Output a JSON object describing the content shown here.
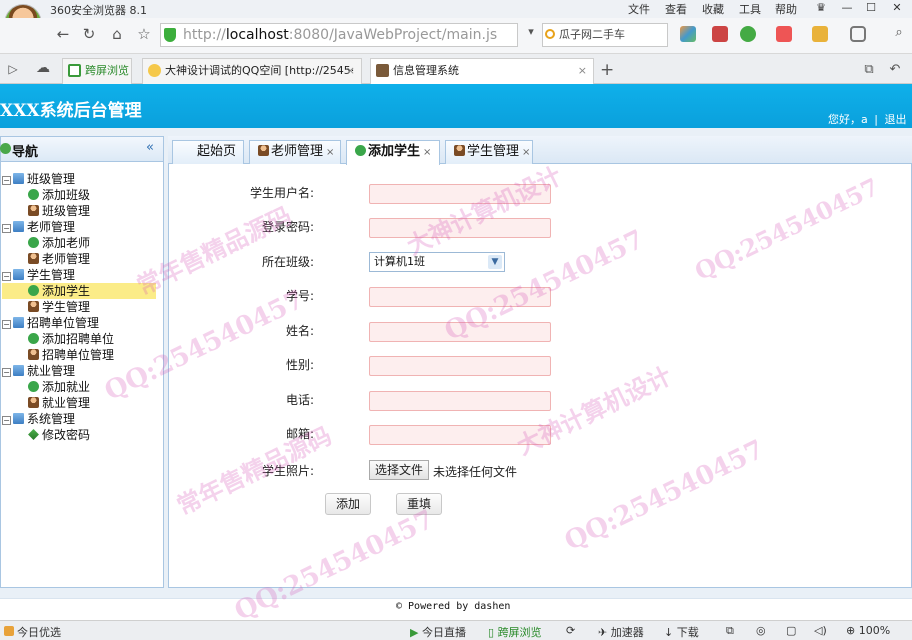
{
  "browser": {
    "title": "360安全浏览器 8.1",
    "menu": [
      "文件",
      "查看",
      "收藏",
      "工具",
      "帮助"
    ],
    "address_prefix": "http://",
    "address_host": "localhost",
    "address_rest": ":8080/JavaWebProject/main.js",
    "search_text": "瓜子网二手车",
    "tabs": [
      {
        "label": "跨屏浏览"
      },
      {
        "label": "大神设计调试的QQ空间 [http://2545·"
      },
      {
        "label": "信息管理系统"
      }
    ],
    "new_tab": "+"
  },
  "app": {
    "title": "XXX系统后台管理",
    "greeting": "您好，a",
    "separator": "|",
    "logout": "退出"
  },
  "nav": {
    "title": "导航",
    "collapse": "«",
    "groups": [
      {
        "label": "班级管理",
        "items": [
          "添加班级",
          "班级管理"
        ]
      },
      {
        "label": "老师管理",
        "items": [
          "添加老师",
          "老师管理"
        ]
      },
      {
        "label": "学生管理",
        "items": [
          "添加学生",
          "学生管理"
        ]
      },
      {
        "label": "招聘单位管理",
        "items": [
          "添加招聘单位",
          "招聘单位管理"
        ]
      },
      {
        "label": "就业管理",
        "items": [
          "添加就业",
          "就业管理"
        ]
      },
      {
        "label": "系统管理",
        "items": [
          "修改密码"
        ]
      }
    ],
    "selected": "添加学生"
  },
  "main_tabs": [
    {
      "label": "起始页",
      "closable": false
    },
    {
      "label": "老师管理",
      "closable": true
    },
    {
      "label": "添加学生",
      "closable": true,
      "active": true
    },
    {
      "label": "学生管理",
      "closable": true
    }
  ],
  "tab_close": "×",
  "form": {
    "username_label": "学生用户名:",
    "password_label": "登录密码:",
    "class_label": "所在班级:",
    "class_value": "计算机1班",
    "number_label": "学号:",
    "name_label": "姓名:",
    "gender_label": "性别:",
    "phone_label": "电话:",
    "email_label": "邮箱:",
    "photo_label": "学生照片:",
    "file_button": "选择文件",
    "file_none": "未选择任何文件",
    "submit": "添加",
    "reset": "重填"
  },
  "footer": "© Powered by dashen",
  "status": {
    "left": "今日优选",
    "live": "今日直播",
    "cross": "跨屏浏览",
    "accel": "加速器",
    "download": "下载",
    "zoom": "100%"
  },
  "watermark": {
    "qq": "QQ:254540457",
    "design": "大神计算机设计",
    "sell": "常年售精品源码"
  }
}
